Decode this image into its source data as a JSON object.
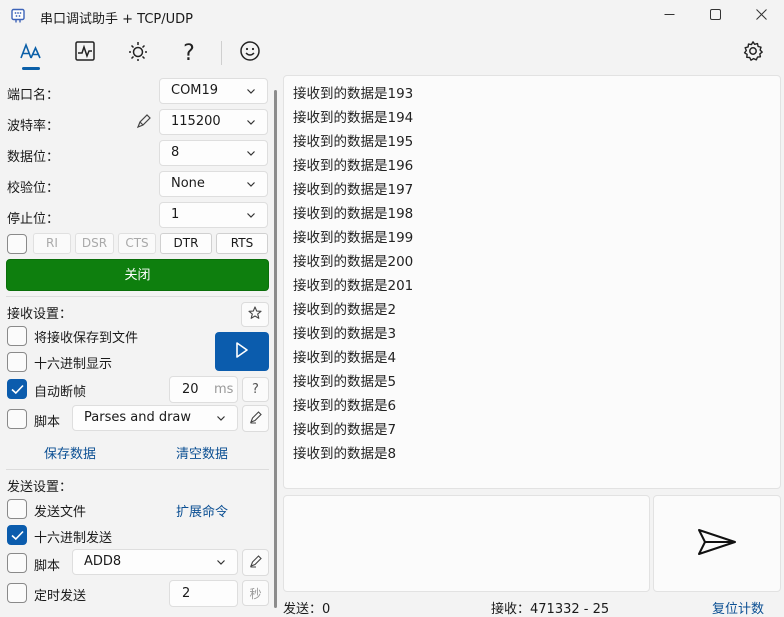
{
  "window": {
    "title": "串口调试助手 + TCP/UDP",
    "icons": [
      "app-icon",
      "minimize-icon",
      "maximize-icon",
      "close-icon"
    ]
  },
  "toolbar": {
    "icons": [
      "font-icon",
      "chart-icon",
      "sun-icon",
      "help-icon",
      "smiley-icon",
      "gear-icon"
    ],
    "help_glyph": "?"
  },
  "serial": {
    "port": {
      "label": "端口名：",
      "value": "COM19"
    },
    "baud": {
      "label": "波特率：",
      "value": "115200"
    },
    "databits": {
      "label": "数据位：",
      "value": "8"
    },
    "parity": {
      "label": "校验位：",
      "value": "None"
    },
    "stopbits": {
      "label": "停止位：",
      "value": "1"
    },
    "pins": [
      "RI",
      "DSR",
      "CTS",
      "DTR",
      "RTS"
    ],
    "open_button": "关闭"
  },
  "receive_settings": {
    "title": "接收设置：",
    "save_to_file": "将接收保存到文件",
    "hex_display": "十六进制显示",
    "auto_frame": "自动断帧",
    "auto_frame_checked": true,
    "frame_value": "20",
    "frame_unit": "ms",
    "help": "?",
    "script_label": "脚本",
    "script_value": "Parses and draw",
    "save_data": "保存数据",
    "clear_data": "清空数据"
  },
  "send_settings": {
    "title": "发送设置：",
    "send_file": "发送文件",
    "extend_cmd": "扩展命令",
    "hex_send": "十六进制发送",
    "hex_send_checked": true,
    "script_label": "脚本",
    "script_value": "ADD8",
    "timed_send": "定时发送",
    "timer_value": "2",
    "timer_unit": "秒"
  },
  "receive_lines": [
    "接收到的数据是193",
    "接收到的数据是194",
    "接收到的数据是195",
    "接收到的数据是196",
    "接收到的数据是197",
    "接收到的数据是198",
    "接收到的数据是199",
    "接收到的数据是200",
    "接收到的数据是201",
    "接收到的数据是2",
    "接收到的数据是3",
    "接收到的数据是4",
    "接收到的数据是5",
    "接收到的数据是6",
    "接收到的数据是7",
    "接收到的数据是8"
  ],
  "status": {
    "sent": "发送：0",
    "received": "接收：471332 - 25",
    "reset": "复位计数"
  },
  "colors": {
    "accent": "#0b5cad",
    "open_button": "#0e7f0e",
    "link": "#0b4f93"
  }
}
